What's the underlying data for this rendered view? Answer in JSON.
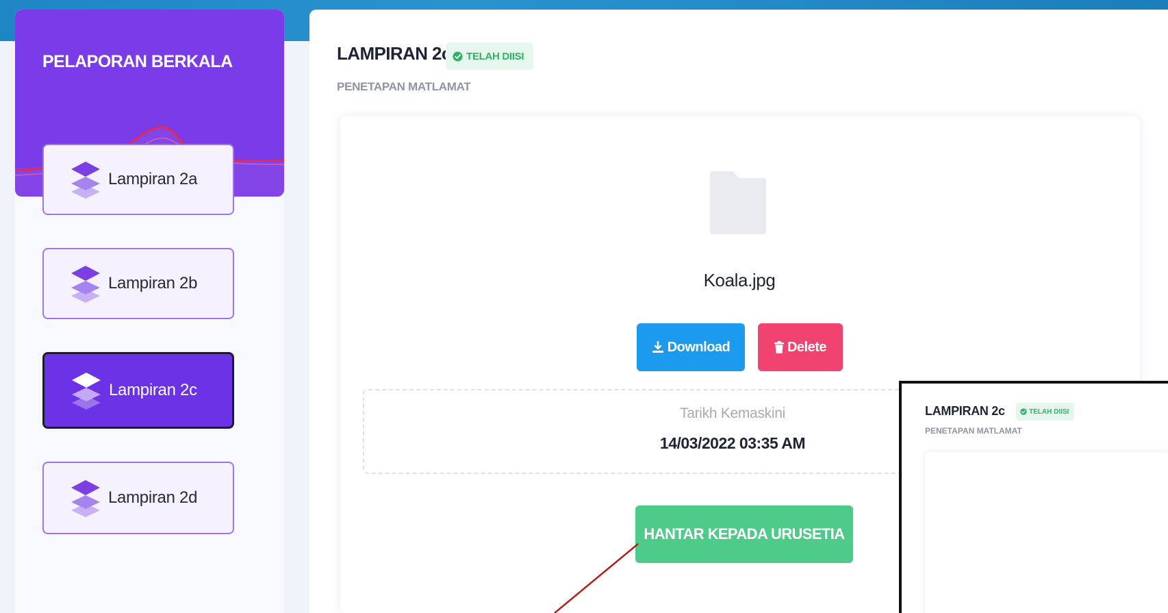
{
  "sidebar": {
    "title": "PELAPORAN BERKALA",
    "items": [
      {
        "label": "Lampiran 2a",
        "active": false,
        "icon": "layers-icon"
      },
      {
        "label": "Lampiran 2b",
        "active": false,
        "icon": "layers-icon"
      },
      {
        "label": "Lampiran 2c",
        "active": true,
        "icon": "layers-icon"
      },
      {
        "label": "Lampiran 2d",
        "active": false,
        "icon": "layers-icon"
      }
    ]
  },
  "main": {
    "title": "LAMPIRAN 2c",
    "status_badge": "TELAH DIISI",
    "subtitle": "PENETAPAN MATLAMAT",
    "file": {
      "icon": "folder-icon",
      "name": "Koala.jpg"
    },
    "actions": {
      "download_label": "Download",
      "delete_label": "Delete"
    },
    "updated": {
      "label": "Tarikh Kemaskini",
      "value": "14/03/2022 03:35 AM"
    },
    "submit_label": "HANTAR KEPADA URUSETIA"
  },
  "inset": {
    "title": "LAMPIRAN 2c",
    "status_badge": "TELAH DIISI",
    "subtitle": "PENETAPAN MATLAMAT"
  },
  "colors": {
    "sidebar_purple": "#7a3be8",
    "active_item": "#6c32e6",
    "download_blue": "#1c9bee",
    "delete_red": "#f0436f",
    "submit_green": "#4ecb88",
    "badge_green": "#2fb367",
    "annotation_red": "#b01e1e"
  }
}
